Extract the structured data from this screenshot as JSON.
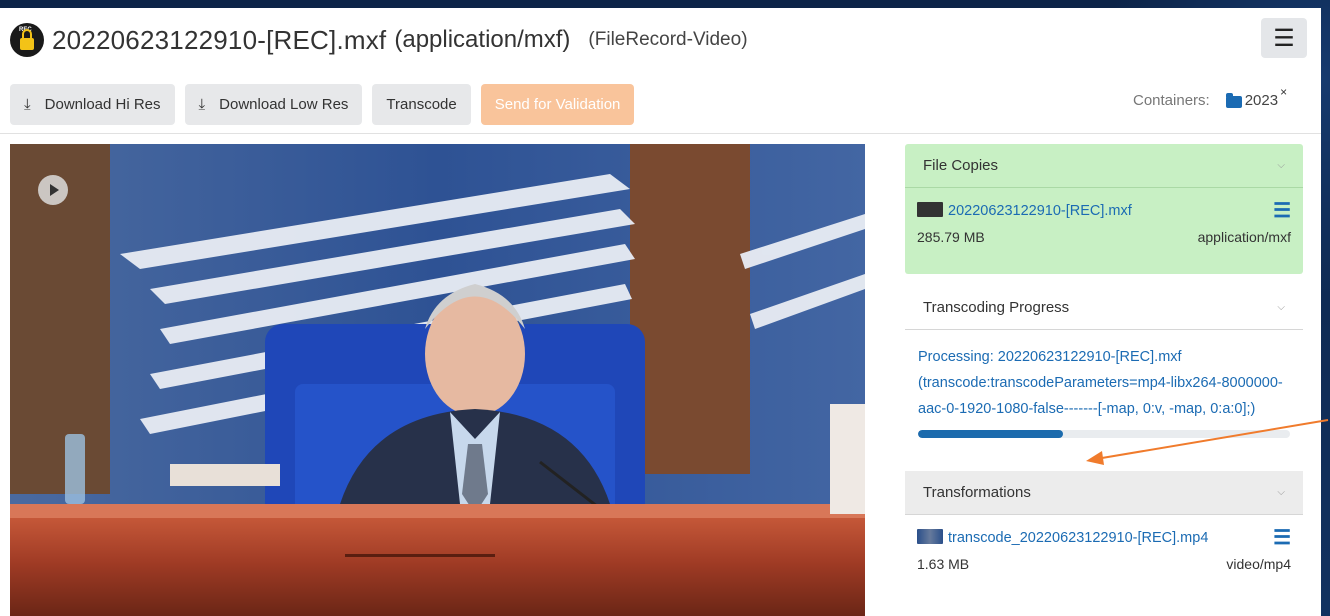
{
  "header": {
    "filename": "20220623122910-[REC].mxf",
    "mime": "(application/mxf)",
    "record_type": "(FileRecord-Video)",
    "menu_icon": "hamburger-icon",
    "menu_glyph": "☰"
  },
  "toolbar": {
    "download_hi": "Download Hi Res",
    "download_low": "Download Low Res",
    "transcode": "Transcode",
    "send_validation": "Send for Validation",
    "download_glyph": "⤓"
  },
  "containers": {
    "label": "Containers:",
    "items": [
      {
        "name": "2023",
        "remove": "×"
      }
    ]
  },
  "video": {
    "play_icon": "play-icon"
  },
  "file_copies": {
    "title": "File Copies",
    "chevron": "⌵",
    "items": [
      {
        "name": "20220623122910-[REC].mxf",
        "size": "285.79 MB",
        "mime": "application/mxf",
        "menu": "☰"
      }
    ]
  },
  "transcoding": {
    "title": "Transcoding Progress",
    "chevron": "⌵",
    "status": "Processing: 20220623122910-[REC].mxf (transcode:transcodeParameters=mp4-libx264-8000000-aac-0-1920-1080-false-------[-map, 0:v, -map, 0:a:0];)",
    "progress": 0.39
  },
  "transformations": {
    "title": "Transformations",
    "chevron": "⌵",
    "items": [
      {
        "name": "transcode_20220623122910-[REC].mp4",
        "size": "1.63 MB",
        "mime": "video/mp4",
        "menu": "☰"
      }
    ]
  },
  "colors": {
    "accent": "#1b6bb3",
    "green_card": "#c8f0c4",
    "validation_btn": "#f9c49b",
    "annotation_arrow": "#f07b2c"
  }
}
